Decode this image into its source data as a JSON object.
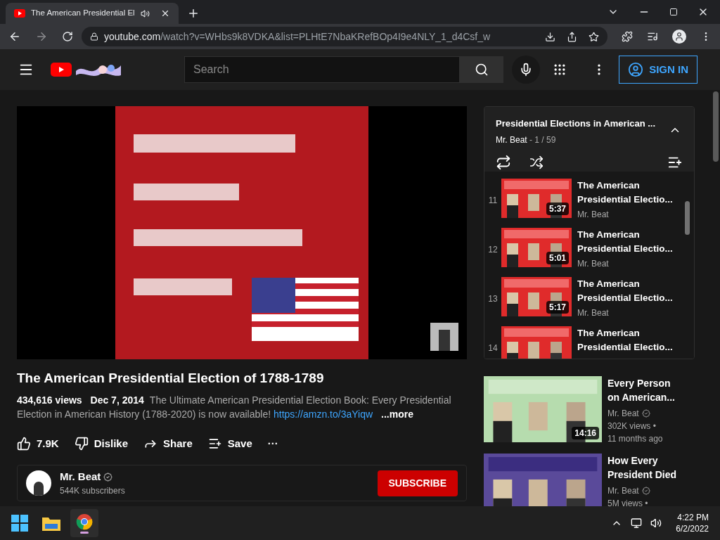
{
  "browser": {
    "tab": {
      "title": "The American Presidential El",
      "audio": true
    },
    "url": {
      "domain": "youtube.com",
      "path": "/watch?v=WHbs9k8VDKA&list=PLHtE7NbaKRefBOp4I9e4NLY_1_d4Csf_w"
    }
  },
  "header": {
    "search": {
      "placeholder": "Search"
    },
    "sign_in": "SIGN IN"
  },
  "video": {
    "title": "The American Presidential Election of 1788-1789",
    "views": "434,616 views",
    "date": "Dec 7, 2014",
    "description": "The Ultimate American Presidential Election Book: Every Presidential Election in American History (1788-2020) is now available!",
    "link": "https://amzn.to/3aYiqw",
    "more": "...more"
  },
  "actions": [
    {
      "kind": "like",
      "label": "7.9K"
    },
    {
      "kind": "dislike",
      "label": "Dislike"
    },
    {
      "kind": "share",
      "label": "Share"
    },
    {
      "kind": "save",
      "label": "Save"
    },
    {
      "kind": "menu",
      "label": "···"
    }
  ],
  "channel": {
    "name": "Mr. Beat",
    "verified": true,
    "subscribers": "544K subscribers",
    "subscribe": "SUBSCRIBE"
  },
  "playlist": {
    "title": "Presidential Elections in American ...",
    "owner": "Mr. Beat",
    "position": "- 1 / 59",
    "items": [
      {
        "index": "11",
        "title_lines": [
          "The American",
          "Presidential Electio..."
        ],
        "channel": "Mr. Beat",
        "duration": "5:37"
      },
      {
        "index": "12",
        "title_lines": [
          "The American",
          "Presidential Electio..."
        ],
        "channel": "Mr. Beat",
        "duration": "5:01"
      },
      {
        "index": "13",
        "title_lines": [
          "The American",
          "Presidential Electio..."
        ],
        "channel": "Mr. Beat",
        "duration": "5:17"
      },
      {
        "index": "14",
        "title_lines": [
          "The American",
          "Presidential Electio..."
        ]
      }
    ]
  },
  "recommended": [
    {
      "title_lines": [
        "Every Person",
        "on American..."
      ],
      "channel": "Mr. Beat",
      "verified": true,
      "views": "302K views •",
      "age": "11 months ago",
      "duration": "14:16"
    },
    {
      "title_lines": [
        "How Every",
        "President Died"
      ],
      "channel": "Mr. Beat",
      "verified": true,
      "views": "5M views •"
    }
  ],
  "taskbar": {
    "time": "4:22 PM",
    "date": "6/2/2022"
  }
}
